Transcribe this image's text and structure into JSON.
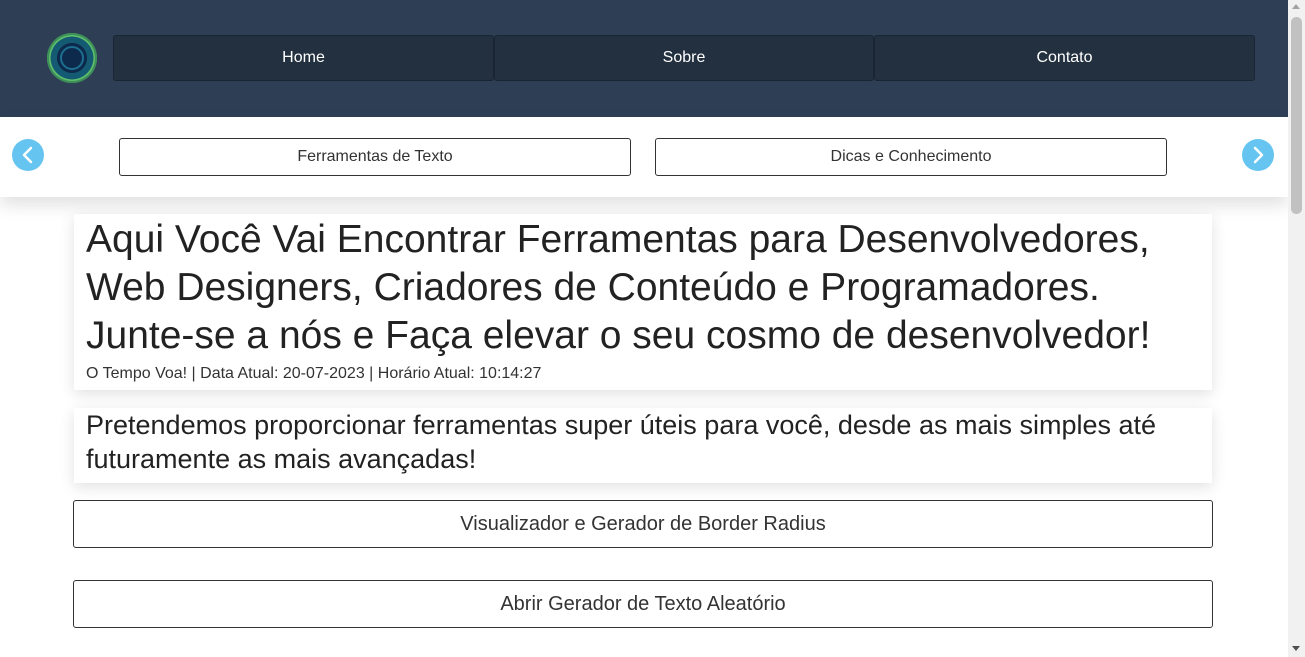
{
  "header": {
    "nav": [
      {
        "label": "Home"
      },
      {
        "label": "Sobre"
      },
      {
        "label": "Contato"
      }
    ]
  },
  "subnav": {
    "items": [
      {
        "label": "Ferramentas de Texto"
      },
      {
        "label": "Dicas e Conhecimento"
      }
    ],
    "prev_icon": "chevron-left-icon",
    "next_icon": "chevron-right-icon"
  },
  "hero": {
    "title_line1": "Aqui Você Vai Encontrar Ferramentas para Desenvolvedores,",
    "title_line2": "Web Designers, Criadores de Conteúdo e Programadores.",
    "title_line3": "Junte-se a nós e Faça elevar o seu cosmo de desenvolvedor!",
    "time_text": "O Tempo Voa! | Data Atual: 20-07-2023 | Horário Atual: 10:14:27"
  },
  "intro": {
    "line1": "Pretendemos proporcionar ferramentas super úteis para você, desde as mais simples até",
    "line2": "futuramente as mais avançadas!"
  },
  "tools": [
    {
      "label": "Visualizador e Gerador de Border Radius"
    },
    {
      "label": "Abrir Gerador de Texto Aleatório"
    }
  ],
  "colors": {
    "header_bg": "#2e3e55",
    "nav_button_bg": "#22303f",
    "arrow_accent": "#65c4f0"
  }
}
